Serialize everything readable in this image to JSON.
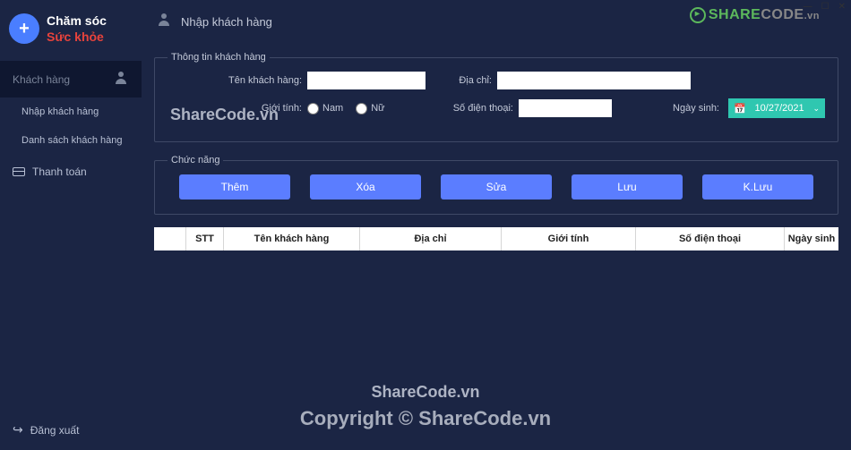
{
  "window": {
    "minimize": "—",
    "maximize": "☐",
    "close": "✕"
  },
  "watermark": {
    "top_green": "SHARE",
    "top_gray": "CODE",
    "top_vn": ".vn",
    "mid1": "ShareCode.vn",
    "mid2": "ShareCode.vn",
    "bottom": "Copyright © ShareCode.vn"
  },
  "brand": {
    "line1": "Chăm sóc",
    "line2": "Sức khỏe"
  },
  "sidebar": {
    "customer": "Khách hàng",
    "sub1": "Nhập khách hàng",
    "sub2": "Danh sách khách hàng",
    "payment": "Thanh toán",
    "logout": "Đăng xuất"
  },
  "topbar": {
    "title": "Nhập khách hàng"
  },
  "form": {
    "legend": "Thông tin khách hàng",
    "name_label": "Tên khách hàng:",
    "addr_label": "Địa chỉ:",
    "gender_label": "Giới tính:",
    "gender_male": "Nam",
    "gender_female": "Nữ",
    "phone_label": "Số điện thoại:",
    "dob_label": "Ngày sinh:",
    "dob_value": "10/27/2021"
  },
  "actions": {
    "legend": "Chức năng",
    "add": "Thêm",
    "del": "Xóa",
    "edit": "Sửa",
    "save": "Lưu",
    "nosave": "K.Lưu"
  },
  "table": {
    "stt": "STT",
    "name": "Tên khách hàng",
    "addr": "Địa chỉ",
    "gender": "Giới tính",
    "phone": "Số điện thoại",
    "dob": "Ngày sinh"
  }
}
